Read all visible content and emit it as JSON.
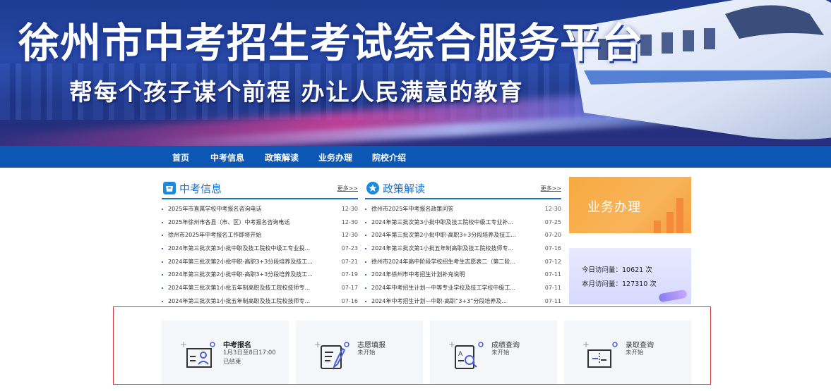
{
  "banner": {
    "title": "徐州市中考招生考试综合服务平台",
    "slogan": "帮每个孩子谋个前程  办让人民满意的教育"
  },
  "nav": {
    "items": [
      "首页",
      "中考信息",
      "政策解读",
      "业务办理",
      "院校介绍"
    ]
  },
  "news": {
    "title": "中考信息",
    "more": "更多>>",
    "items": [
      {
        "title": "2025年市直属学校中考报名咨询电话",
        "date": "12-30"
      },
      {
        "title": "2025年徐州市各县（市、区）中考报名咨询电话",
        "date": "12-30"
      },
      {
        "title": "徐州市2025年中考报名工作即将开始",
        "date": "12-30"
      },
      {
        "title": "2024年第三批次第3小批中职及技工院校中级工专业投...",
        "date": "07-23"
      },
      {
        "title": "2024年第三批次第2小批中职-高职3+3分段培养及技工...",
        "date": "07-21"
      },
      {
        "title": "2024年第三批次第2小批中职-高职3+3分段培养及技工...",
        "date": "07-19"
      },
      {
        "title": "2024年第三批次第1小批五年制高职及技工院校技师专...",
        "date": "07-17"
      },
      {
        "title": "2024年第三批次第1小批五年制高职及技工院校技师专...",
        "date": "07-16"
      }
    ]
  },
  "policy": {
    "title": "政策解读",
    "more": "更多>>",
    "items": [
      {
        "title": "徐州市2025年中考报名政策问答",
        "date": "12-30"
      },
      {
        "title": "2024年第三批次第3小批中职及技工院校中级工专业补...",
        "date": "07-25"
      },
      {
        "title": "2024年第三批次第2小批中职-高职3+3分段培养及技工...",
        "date": "07-20"
      },
      {
        "title": "2024年第三批次第1小批五年制高职及技工院校技师专...",
        "date": "07-16"
      },
      {
        "title": "徐州市2024年高中阶段学校招生考生志愿表二（第二阶...",
        "date": "07-12"
      },
      {
        "title": "2024年徐州市中考招生计划补充说明",
        "date": "07-11"
      },
      {
        "title": "2024年中考招生计划—中等专业学校及技工学校中级工...",
        "date": "07-11"
      },
      {
        "title": "2024年中考招生计划—中职-高职“3+3”分段培养及...",
        "date": "07-11"
      }
    ]
  },
  "side": {
    "business_label": "业务办理",
    "visits_today": "今日访问量：10621 次",
    "visits_month": "本月访问量：127310 次"
  },
  "services": [
    {
      "name": "中考报名",
      "line1": "1月3日至8日17:00",
      "line2": "已结束",
      "icon": "id-card-icon"
    },
    {
      "name": "志愿填报",
      "line1": "未开始",
      "line2": "",
      "icon": "form-pen-icon"
    },
    {
      "name": "成绩查询",
      "line1": "未开始",
      "line2": "",
      "icon": "score-search-icon"
    },
    {
      "name": "录取查询",
      "line1": "未开始",
      "line2": "",
      "icon": "admission-envelope-icon"
    }
  ],
  "colors": {
    "nav_bg": "#0b57b3",
    "accent_blue": "#1a6fcf",
    "highlight_border": "#d0363c",
    "business_orange": "#f7a940",
    "visits_lavender": "#d7d8ff"
  }
}
